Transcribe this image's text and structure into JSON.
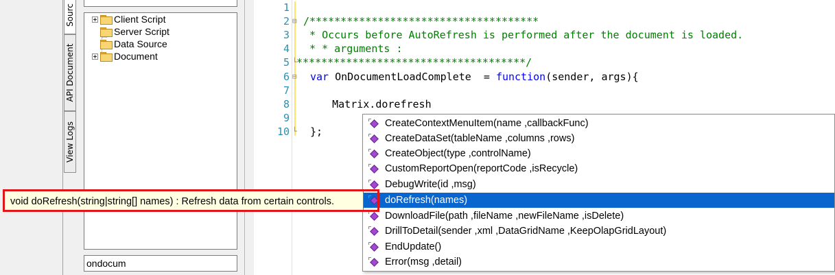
{
  "side_tabs": {
    "source": "Sourc",
    "api_document": "API Document",
    "view_logs": "View Logs"
  },
  "tree": {
    "items": [
      {
        "label": "Client Script",
        "expandable": true
      },
      {
        "label": "Server Script",
        "expandable": false
      },
      {
        "label": "Data Source",
        "expandable": false
      },
      {
        "label": "Document",
        "expandable": true
      }
    ]
  },
  "search": {
    "value": "ondocum"
  },
  "editor": {
    "lines": [
      {
        "num": "1",
        "text": ""
      },
      {
        "num": "2",
        "text": "/*************************************"
      },
      {
        "num": "3",
        "text": " * Occurs before AutoRefresh is performed after the document is loaded."
      },
      {
        "num": "4",
        "text": " * * arguments :"
      },
      {
        "num": "5",
        "text": "*************************************/"
      },
      {
        "num": "6",
        "kw1": "var",
        "name": " OnDocumentLoadComplete  = ",
        "kw2": "function",
        "rest": "(sender, args){"
      },
      {
        "num": "7",
        "text": ""
      },
      {
        "num": "8",
        "text": "    Matrix.dorefresh"
      },
      {
        "num": "9",
        "text": ""
      },
      {
        "num": "10",
        "text": "};"
      }
    ]
  },
  "autocomplete": {
    "items": [
      "CreateContextMenuItem(name ,callbackFunc)",
      "CreateDataSet(tableName ,columns ,rows)",
      "CreateObject(type ,controlName)",
      "CustomReportOpen(reportCode ,isRecycle)",
      "DebugWrite(id ,msg)",
      "doRefresh(names)",
      "DownloadFile(path ,fileName ,newFileName ,isDelete)",
      "DrillToDetail(sender ,xml ,DataGridName ,KeepOlapGridLayout)",
      "EndUpdate()",
      "Error(msg ,detail)"
    ],
    "selected_index": 5,
    "icon": "method-icon",
    "selected_color": "#0a66cf"
  },
  "tooltip": {
    "text": "void doRefresh(string|string[] names) : Refresh data from certain controls.",
    "highlight_color": "#e0161a"
  }
}
